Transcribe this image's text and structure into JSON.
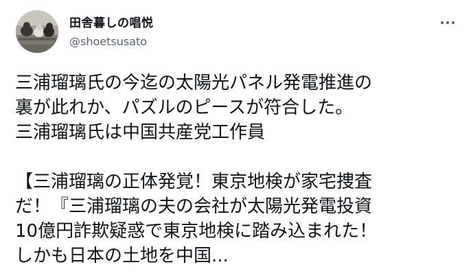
{
  "tweet": {
    "author": {
      "display_name": "田舎暮しの唱悦",
      "handle": "@shoetsusato",
      "avatar_icon": "cats-photo-avatar"
    },
    "more_icon": "more-horizontal-icon",
    "text_lines": [
      "三浦瑠璃氏の今迄の太陽光パネル発電推進の",
      "裏が此れか、パズルのピースが符合した。",
      "三浦瑠璃氏は中国共産党工作員",
      "",
      "【三浦瑠璃の正体発覚！東京地検が家宅捜査",
      "だ！『三浦瑠璃の夫の会社が太陽光発電投資",
      "10億円詐欺疑惑で東京地検に踏み込まれた！",
      "しかも日本の土地を中国..."
    ]
  },
  "colors": {
    "text_primary": "#0f1419",
    "text_secondary": "#536471",
    "background": "#ffffff"
  }
}
